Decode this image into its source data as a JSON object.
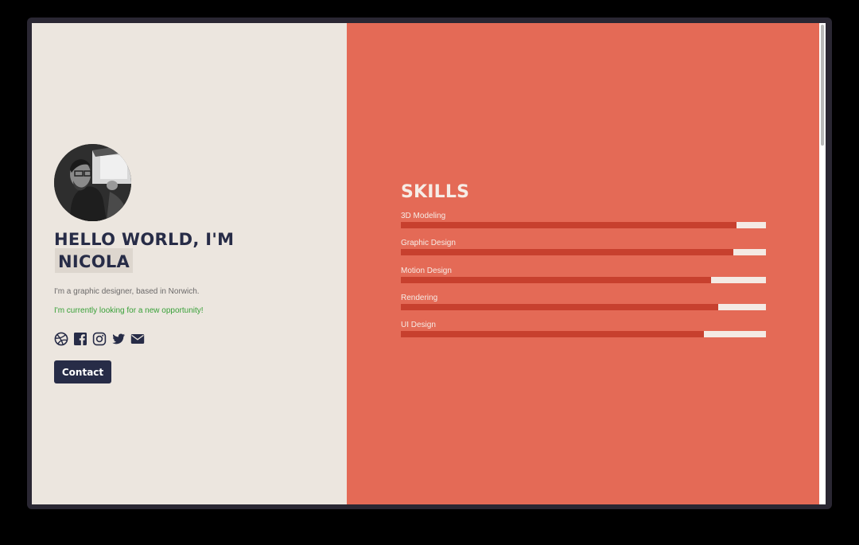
{
  "profile": {
    "greeting": "HELLO WORLD, I'M",
    "name": "NICOLA",
    "bio": "I'm a graphic designer, based in Norwich.",
    "status": "I'm currently looking for a new opportunity!",
    "avatar_icon": "profile-photo"
  },
  "social": [
    {
      "icon": "dribbble-icon"
    },
    {
      "icon": "facebook-icon"
    },
    {
      "icon": "instagram-icon"
    },
    {
      "icon": "twitter-icon"
    },
    {
      "icon": "email-icon"
    }
  ],
  "contact": {
    "label": "Contact"
  },
  "skills": {
    "title": "SKILLS",
    "items": [
      {
        "label": "3D Modeling",
        "level": 0.92
      },
      {
        "label": "Graphic Design",
        "level": 0.91
      },
      {
        "label": "Motion Design",
        "level": 0.85
      },
      {
        "label": "Rendering",
        "level": 0.87
      },
      {
        "label": "UI Design",
        "level": 0.83
      }
    ]
  },
  "colors": {
    "left_background": "#ece6df",
    "right_background": "#e46a56",
    "heading": "#272c47",
    "accent_green": "#38a038",
    "bar_fill": "#c7402e",
    "bar_track": "#f4eae4"
  }
}
